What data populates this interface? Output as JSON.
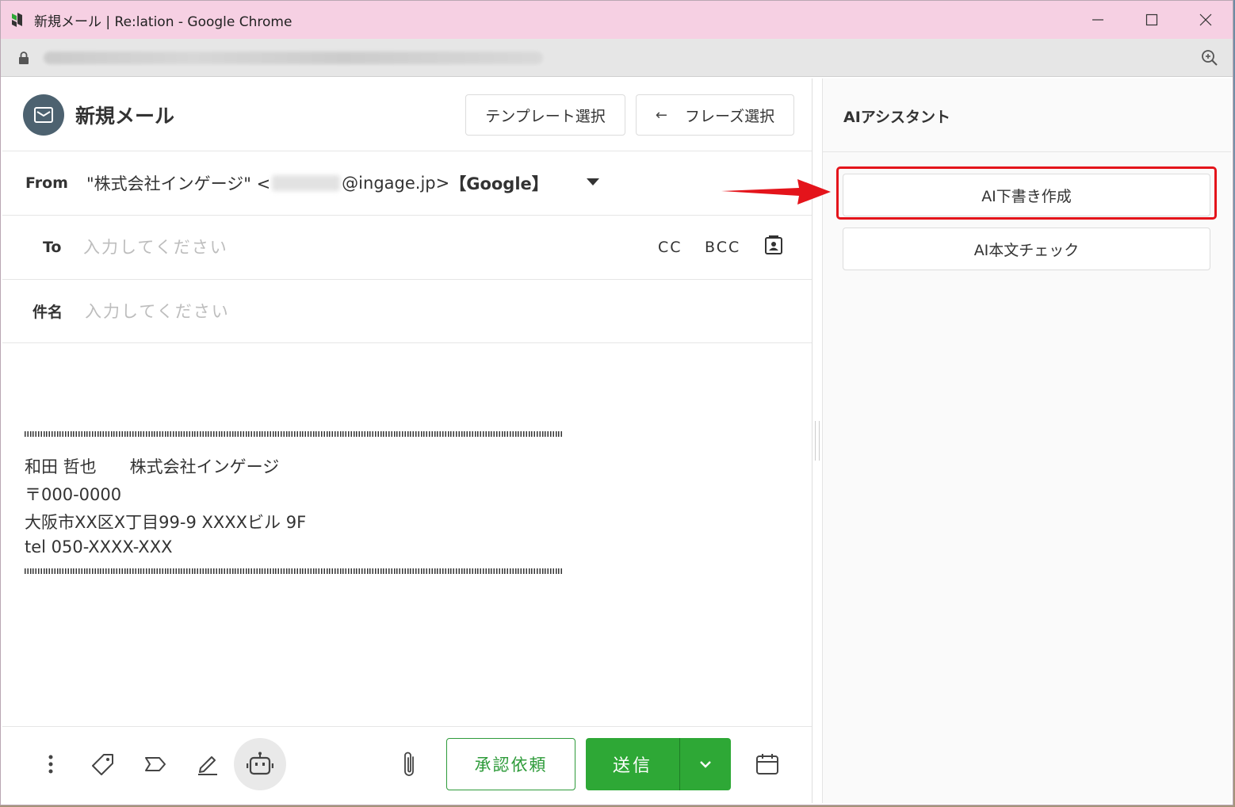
{
  "window": {
    "title": "新規メール | Re:lation - Google Chrome"
  },
  "compose": {
    "title": "新規メール",
    "template_button": "テンプレート選択",
    "phrase_button": "フレーズ選択",
    "from_label": "From",
    "from_prefix": "\"株式会社インゲージ\" <",
    "from_domain": "@ingage.jp>",
    "from_suffix": "【Google】",
    "to_label": "To",
    "to_placeholder": "入力してください",
    "cc_label": "CC",
    "bcc_label": "BCC",
    "subject_label": "件名",
    "subject_placeholder": "入力してください",
    "signature": {
      "line1": "和田 哲也　　株式会社インゲージ",
      "line2": "〒000-0000",
      "line3": "大阪市XX区X丁目99-9 XXXXビル 9F",
      "line4": "tel 050-XXXX-XXX"
    },
    "approve_button": "承認依頼",
    "send_button": "送信"
  },
  "assistant": {
    "title": "AIアシスタント",
    "draft_button": "AI下書き作成",
    "check_button": "AI本文チェック"
  },
  "icons": {
    "app": "relation-logo-icon",
    "lock": "lock-icon",
    "zoom": "zoom-icon",
    "mail": "mail-icon",
    "contacts": "address-book-icon",
    "more": "more-vertical-icon",
    "tag": "tag-icon",
    "label": "label-icon",
    "pen": "pen-icon",
    "robot": "robot-icon",
    "clip": "paperclip-icon",
    "calendar": "calendar-icon"
  },
  "colors": {
    "titlebar": "#f6d0e3",
    "send": "#2ea836",
    "highlight": "#e4141b"
  }
}
